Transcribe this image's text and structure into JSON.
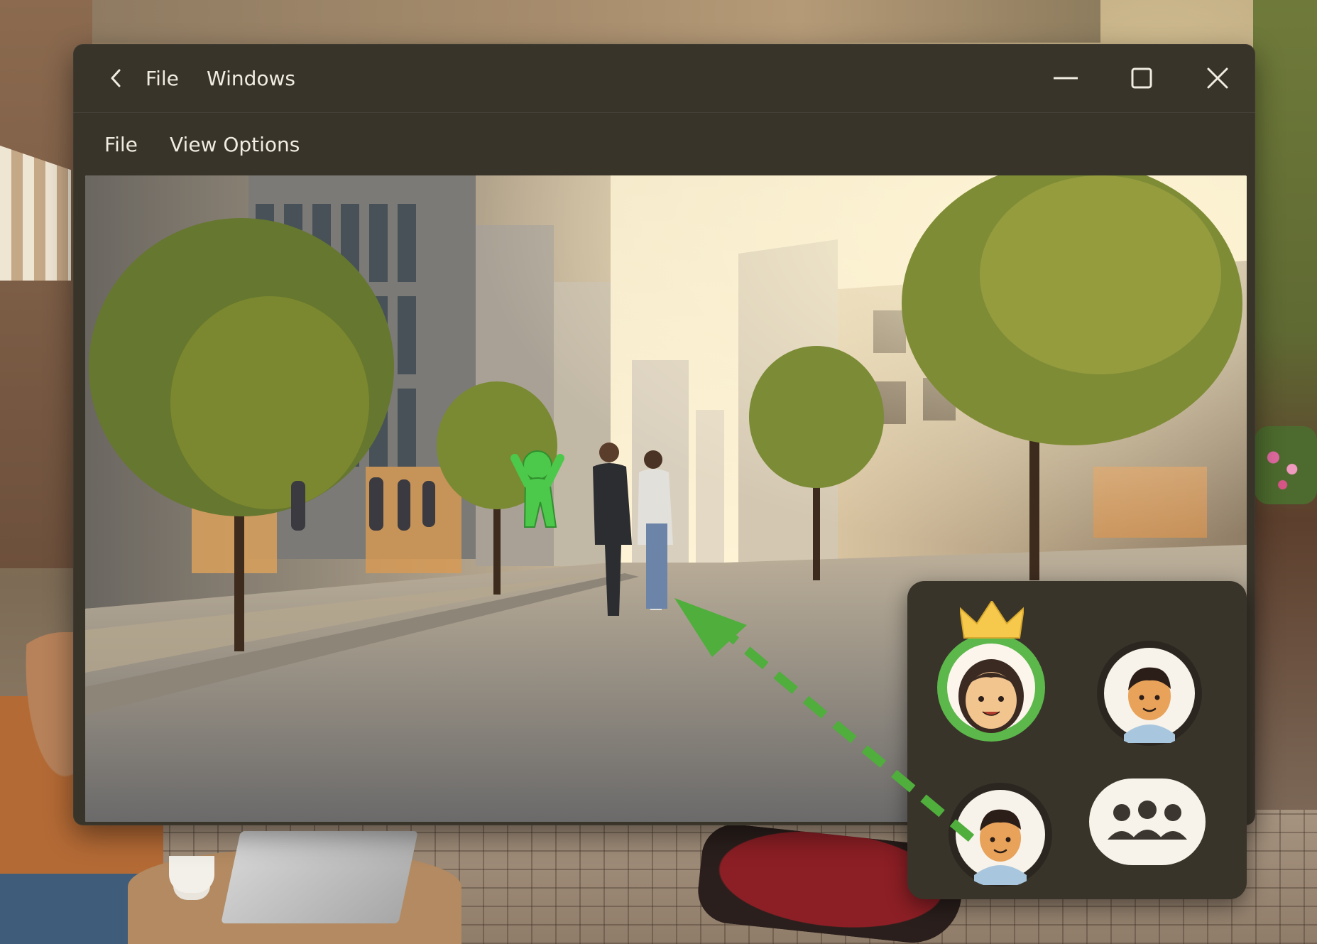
{
  "titlebar": {
    "menu": [
      "File",
      "Windows"
    ],
    "controls": [
      "minimize",
      "maximize",
      "close"
    ]
  },
  "menubar": {
    "items": [
      "File",
      "View Options"
    ]
  },
  "viewport": {
    "scene": "sunlit city street",
    "avatar_marker": "green-figure-icon"
  },
  "avatar_picker": {
    "selected": "crowned-girl-avatar",
    "avatars": [
      "crowned-girl-avatar",
      "boy-avatar",
      "boy-avatar-2",
      "group-avatar"
    ]
  },
  "colors": {
    "window_bg": "#39342a",
    "accent_green": "#5cb84a",
    "text": "#f1ece2",
    "crown": "#f6c94c"
  }
}
